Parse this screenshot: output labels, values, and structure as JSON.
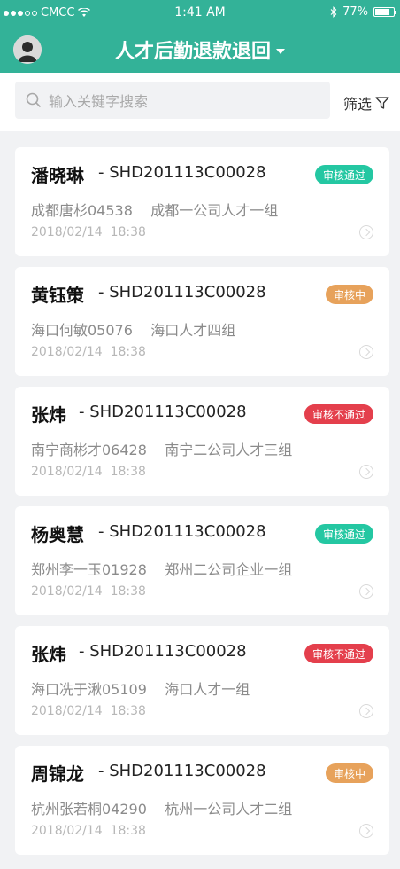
{
  "status_bar": {
    "carrier": "CMCC",
    "time": "1:41 AM",
    "battery": "77%"
  },
  "header": {
    "title": "人才后勤退款退回"
  },
  "search": {
    "placeholder": "输入关键字搜索",
    "filter_label": "筛选"
  },
  "colors": {
    "brand": "#33b298",
    "approved": "#24c7a2",
    "pending": "#e7a25b",
    "rejected": "#e43f4c"
  },
  "cards": [
    {
      "name": "潘晓琳",
      "code": "- SHD201113C00028",
      "status": "审核通过",
      "status_type": "approved",
      "meta": "成都唐杉04538    成都一公司人才一组",
      "date": "2018/02/14  18:38"
    },
    {
      "name": "黄钰策",
      "code": "- SHD201113C00028",
      "status": "审核中",
      "status_type": "pending",
      "meta": "海口何敏05076    海口人才四组",
      "date": "2018/02/14  18:38"
    },
    {
      "name": "张炜",
      "code": "- SHD201113C00028",
      "status": "审核不通过",
      "status_type": "rejected",
      "meta": "南宁商彬才06428    南宁二公司人才三组",
      "date": "2018/02/14  18:38"
    },
    {
      "name": "杨奥慧",
      "code": "- SHD201113C00028",
      "status": "审核通过",
      "status_type": "approved",
      "meta": "郑州李一玉01928    郑州二公司企业一组",
      "date": "2018/02/14  18:38"
    },
    {
      "name": "张炜",
      "code": "- SHD201113C00028",
      "status": "审核不通过",
      "status_type": "rejected",
      "meta": "海口冼于湫05109    海口人才一组",
      "date": "2018/02/14  18:38"
    },
    {
      "name": "周锦龙",
      "code": "- SHD201113C00028",
      "status": "审核中",
      "status_type": "pending",
      "meta": "杭州张若桐04290    杭州一公司人才二组",
      "date": "2018/02/14  18:38"
    }
  ]
}
